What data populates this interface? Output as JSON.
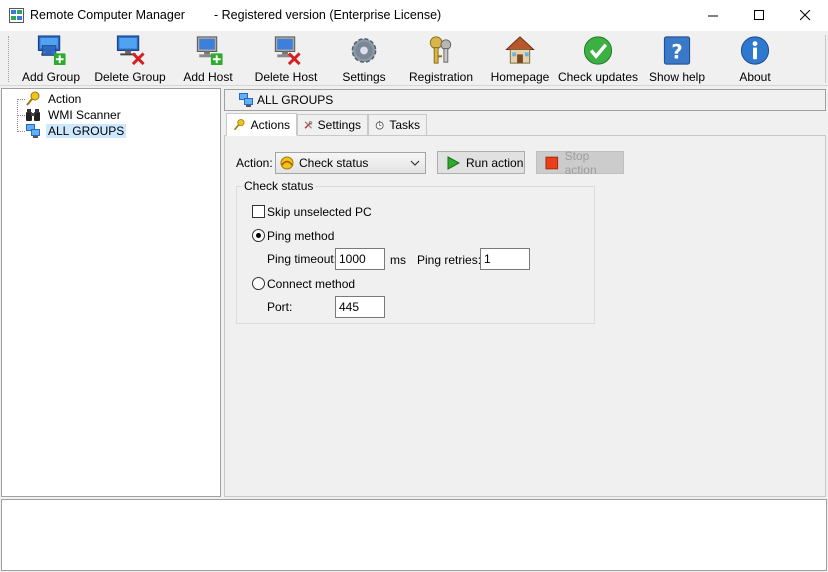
{
  "window": {
    "title": "Remote Computer Manager",
    "registration": "- Registered version (Enterprise License)"
  },
  "toolbar": {
    "add_group": "Add Group",
    "delete_group": "Delete Group",
    "add_host": "Add Host",
    "delete_host": "Delete Host",
    "settings": "Settings",
    "registration": "Registration",
    "homepage": "Homepage",
    "check_updates": "Check updates",
    "show_help": "Show help",
    "about": "About"
  },
  "tree": {
    "items": [
      {
        "label": "Action",
        "icon": "key-icon"
      },
      {
        "label": "WMI Scanner",
        "icon": "binoculars-icon"
      },
      {
        "label": "ALL GROUPS",
        "icon": "computers-icon",
        "selected": true
      }
    ]
  },
  "main": {
    "header": "ALL GROUPS",
    "tabs": [
      {
        "label": "Actions",
        "icon": "key-icon",
        "active": true
      },
      {
        "label": "Settings",
        "icon": "tools-icon"
      },
      {
        "label": "Tasks",
        "icon": "stopwatch-icon"
      }
    ],
    "action_label": "Action:",
    "action_value": "Check status",
    "run_action": "Run action",
    "stop_action": "Stop action",
    "check_status": {
      "title": "Check status",
      "skip_unselected": "Skip unselected PC",
      "skip_checked": false,
      "ping_method": "Ping method",
      "ping_selected": true,
      "ping_timeout_label": "Ping timeout:",
      "ping_timeout_value": "1000",
      "ms": "ms",
      "ping_retries_label": "Ping retries:",
      "ping_retries_value": "1",
      "connect_method": "Connect method",
      "port_label": "Port:",
      "port_value": "445"
    }
  },
  "colors": {
    "selection": "#cde8ff",
    "run_green": "#2eaa2e",
    "stop_red": "#e8401c"
  }
}
